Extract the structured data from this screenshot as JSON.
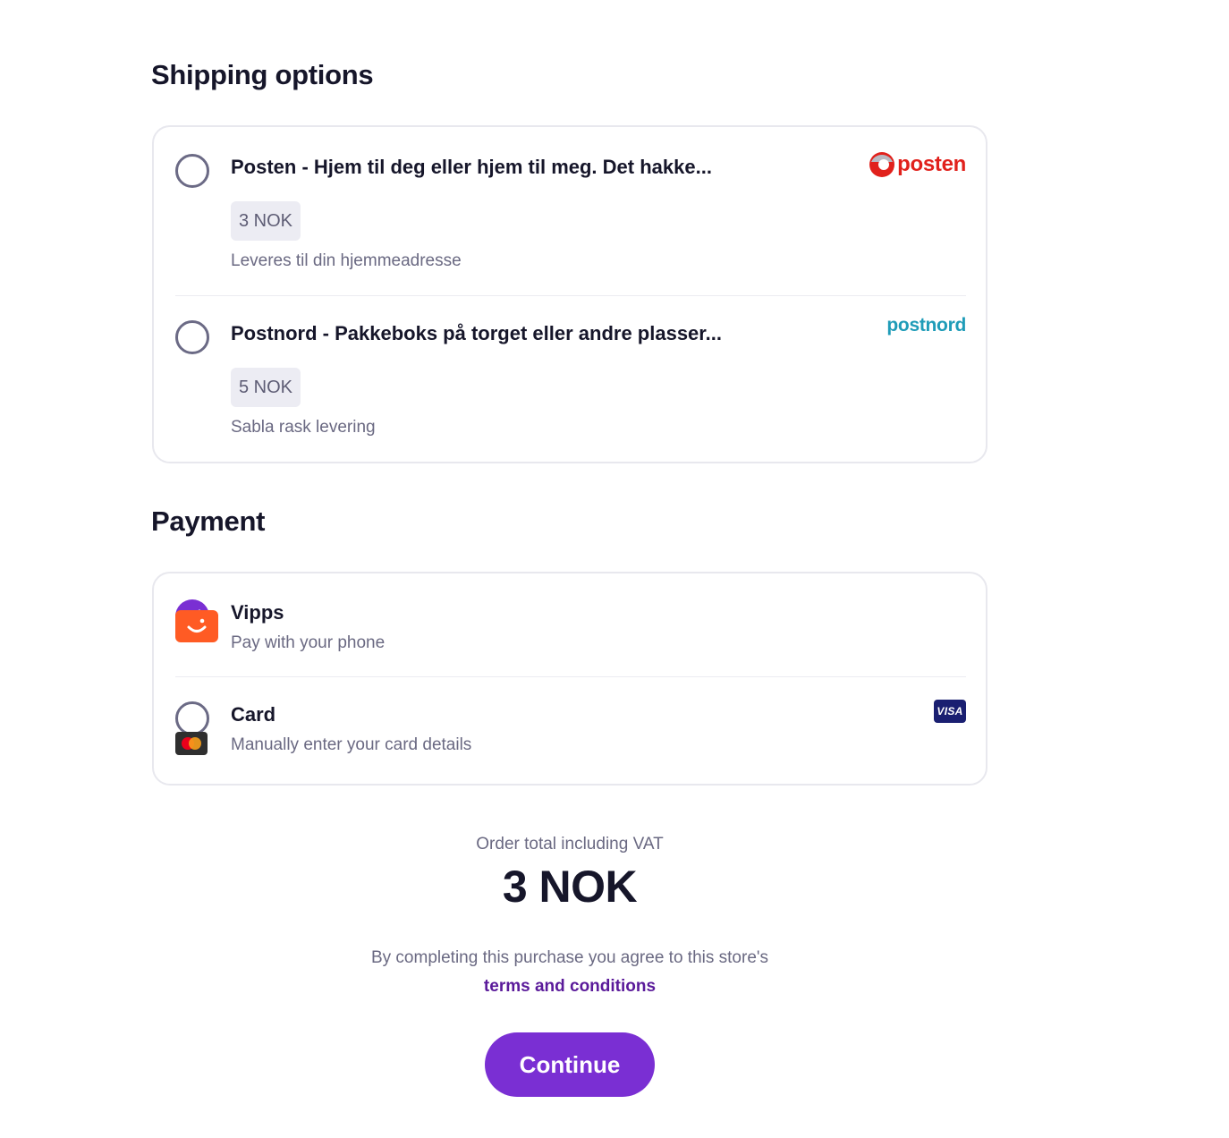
{
  "shipping": {
    "title": "Shipping options",
    "options": [
      {
        "title": "Posten - Hjem til deg eller hjem til meg. Det hakke...",
        "price": "3 NOK",
        "description": "Leveres til din hjemmeadresse",
        "logo_text": "posten",
        "logo_icon": "posten-logo",
        "selected": false
      },
      {
        "title": "Postnord - Pakkeboks på torget eller andre plasser...",
        "price": "5 NOK",
        "description": "Sabla rask levering",
        "logo_text": "postnord",
        "logo_icon": "postnord-logo",
        "selected": false
      }
    ]
  },
  "payment": {
    "title": "Payment",
    "options": [
      {
        "title": "Vipps",
        "description": "Pay with your phone",
        "logo_icon": "vipps-logo",
        "selected": true
      },
      {
        "title": "Card",
        "description": "Manually enter your card details",
        "logo_icons": [
          "visa-logo",
          "mastercard-logo"
        ],
        "visa_text": "VISA",
        "selected": false
      }
    ]
  },
  "order": {
    "total_label": "Order total including VAT",
    "total_value": "3 NOK",
    "agree_text": "By completing this purchase you agree to this store's",
    "terms_link": "terms and conditions",
    "continue_label": "Continue"
  },
  "colors": {
    "accent": "#7a2fd3",
    "posten_red": "#e1211c",
    "postnord_blue": "#1f9cb8",
    "vipps_orange": "#ff5b24",
    "visa_blue": "#1a1f71"
  }
}
